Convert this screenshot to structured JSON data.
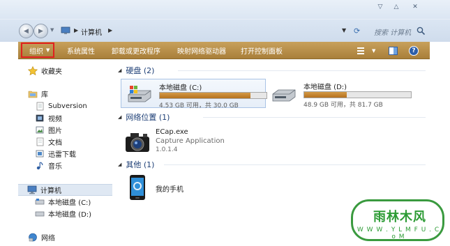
{
  "window": {
    "controls": {
      "minimize": "▽",
      "maximize": "△",
      "close": "✕"
    }
  },
  "address": {
    "path": "计算机",
    "search_placeholder": "搜索 计算机"
  },
  "toolbar": {
    "organize": "组织",
    "system_properties": "系统属性",
    "uninstall": "卸载或更改程序",
    "map_drive": "映射网络驱动器",
    "control_panel": "打开控制面板",
    "help": "?"
  },
  "nav": {
    "favorites": "收藏夹",
    "libraries": "库",
    "subversion": "Subversion",
    "videos": "视频",
    "pictures": "图片",
    "documents": "文档",
    "xunlei": "迅雷下载",
    "music": "音乐",
    "computer": "计算机",
    "drive_c": "本地磁盘 (C:)",
    "drive_d": "本地磁盘 (D:)",
    "network": "网络"
  },
  "groups": {
    "hard_disks": "硬盘 (2)",
    "network_locations": "网络位置 (1)",
    "other": "其他 (1)"
  },
  "drives": [
    {
      "name": "本地磁盘 (C:)",
      "free": "4.53 GB 可用，共 30.0 GB",
      "used_fraction": 0.849
    },
    {
      "name": "本地磁盘 (D:)",
      "free": "48.9 GB 可用，共 81.7 GB",
      "used_fraction": 0.401
    }
  ],
  "network_item": {
    "name": "ECap.exe",
    "description": "Capture Application",
    "version": "1.0.1.4"
  },
  "other_item": {
    "name": "我的手机"
  },
  "watermark": {
    "text": "雨林木风",
    "url": "W W W . Y L M F U . C o M"
  }
}
